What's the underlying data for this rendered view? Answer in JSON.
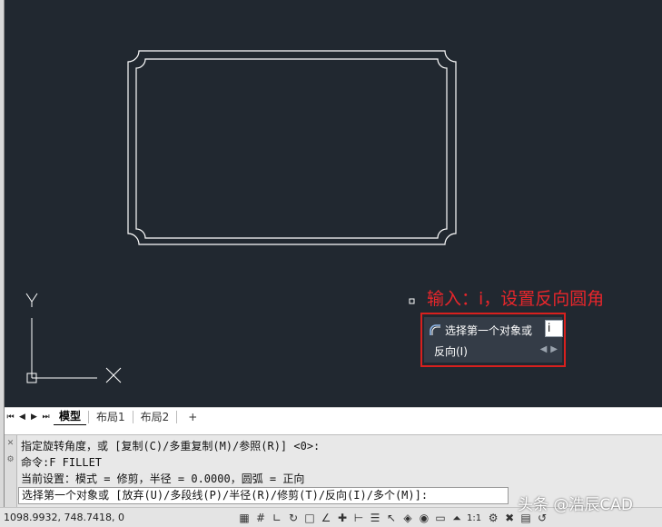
{
  "canvas": {
    "callout_text": "输入：i，设置反向圆角",
    "prompt": {
      "label": "选择第一个对象或",
      "input_value": "i",
      "option_label": "反向(I)"
    },
    "ucs_labels": {
      "y": "Y",
      "x": "X"
    }
  },
  "tabs": {
    "items": [
      {
        "label": "模型",
        "active": true
      },
      {
        "label": "布局1",
        "active": false
      },
      {
        "label": "布局2",
        "active": false
      },
      {
        "label": "+",
        "active": false
      }
    ]
  },
  "command": {
    "history": [
      "指定旋转角度，或 [复制(C)/多重复制(M)/参照(R)] <0>:",
      "命令:F FILLET",
      "当前设置：模式 = 修剪，半径 = 0.0000，圆弧 = 正向"
    ],
    "input_text": "选择第一个对象或 [放弃(U)/多段线(P)/半径(R)/修剪(T)/反向(I)/多个(M)]:"
  },
  "status": {
    "coordinates": "1098.9932, 748.7418, 0",
    "scale": "1:1"
  },
  "watermark": "头条 @浩辰CAD",
  "colors": {
    "canvas_bg": "#212830",
    "geometry": "#ffffff",
    "highlight": "#d8201e"
  }
}
